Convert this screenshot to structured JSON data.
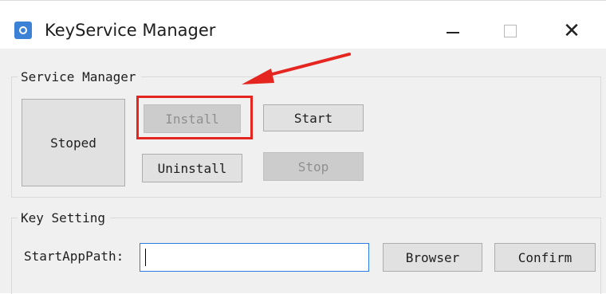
{
  "window": {
    "title": "KeyService Manager",
    "icon": "gear-app-icon",
    "controls": {
      "minimize": "—",
      "maximize": "☐",
      "close": "✕"
    }
  },
  "service_manager": {
    "legend": "Service Manager",
    "status": "Stoped",
    "install_label": "Install",
    "install_enabled": false,
    "start_label": "Start",
    "uninstall_label": "Uninstall",
    "stop_label": "Stop",
    "stop_enabled": false
  },
  "key_setting": {
    "legend": "Key Setting",
    "start_app_path_label": "StartAppPath:",
    "start_app_path_value": "",
    "browser_label": "Browser",
    "confirm_label": "Confirm"
  },
  "annotation": {
    "color": "#e52620",
    "target": "install-button"
  }
}
